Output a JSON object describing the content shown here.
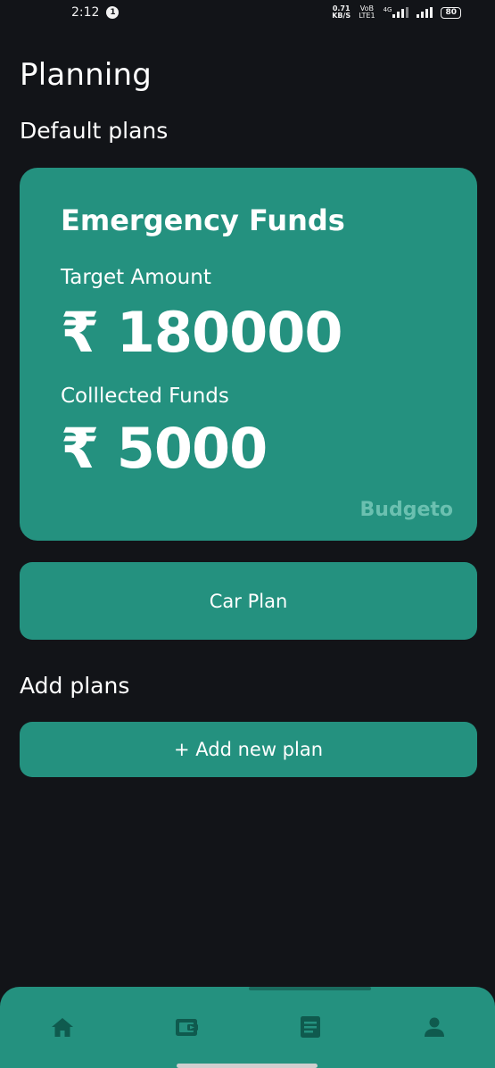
{
  "status_bar": {
    "time": "2:12",
    "notification_count": "1",
    "net_speed_value": "0.71",
    "net_speed_unit": "KB/S",
    "volte_top": "VoB",
    "volte_bottom": "LTE1",
    "signal_type": "4G",
    "battery": "80"
  },
  "header": {
    "title": "Planning"
  },
  "default_plans": {
    "section_title": "Default plans",
    "card": {
      "name": "Emergency Funds",
      "target_label": "Target Amount",
      "target_amount": "₹ 180000",
      "collected_label": "Colllected Funds",
      "collected_amount": "₹ 5000",
      "brand": "Budgeto"
    },
    "car_plan_label": "Car Plan"
  },
  "add_plans": {
    "section_title": "Add plans",
    "add_button_label": "+ Add new plan"
  },
  "bottom_nav": {
    "items": [
      {
        "icon": "home-icon"
      },
      {
        "icon": "wallet-icon"
      },
      {
        "icon": "notes-icon"
      },
      {
        "icon": "profile-icon"
      }
    ]
  },
  "colors": {
    "background": "#121418",
    "accent": "#24917f",
    "nav_icon": "#0f5a4e",
    "brand_text": "#6bc0b0"
  }
}
